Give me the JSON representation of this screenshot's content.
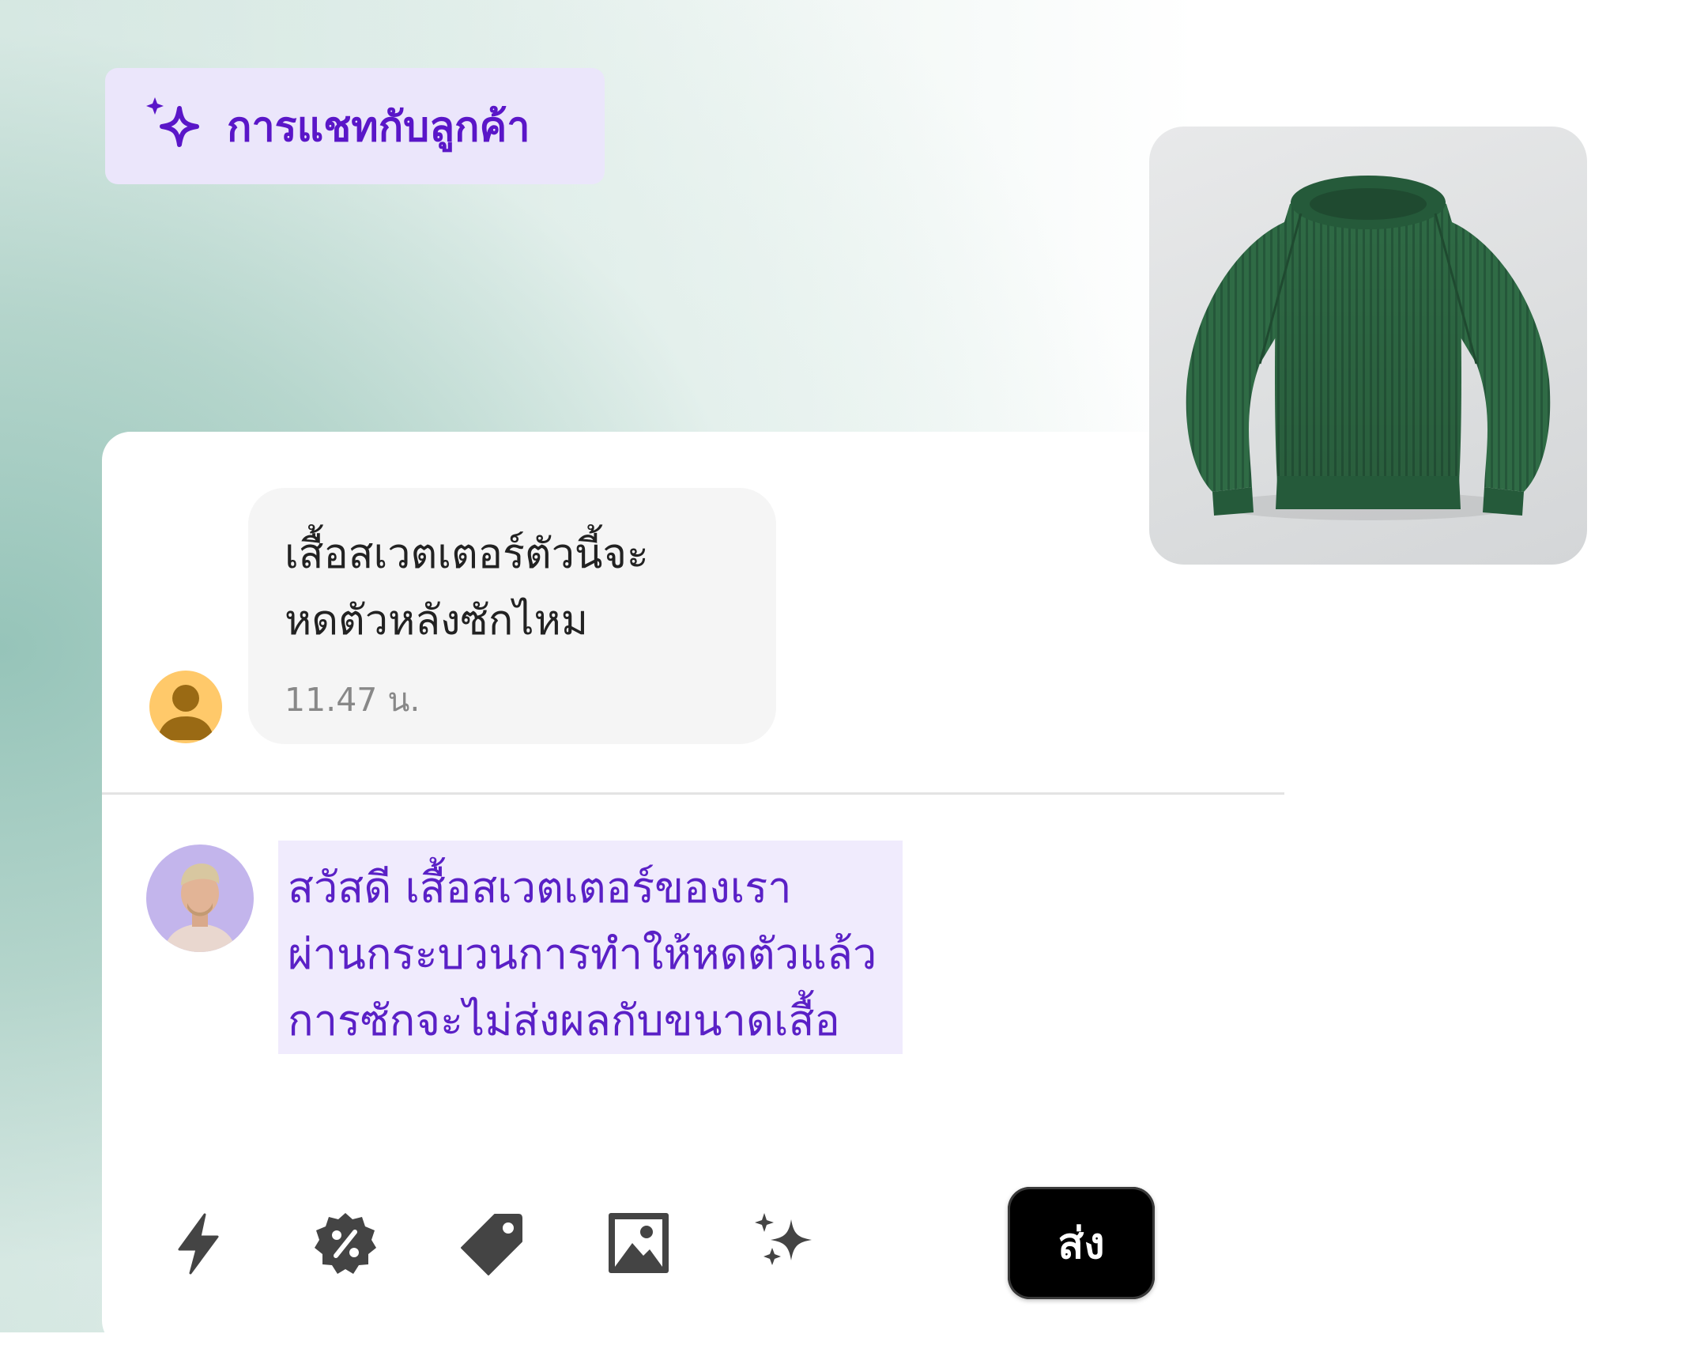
{
  "header": {
    "title": "การแชทกับลูกค้า",
    "icon": "sparkle-icon",
    "accent_color": "#5a16c8",
    "badge_color": "#ebe6fb"
  },
  "product": {
    "image_icon": "green-sweater-image"
  },
  "customer_message": {
    "lines": [
      "เสื้อสเวตเตอร์ตัวนี้จะ",
      "หดตัวหลังซักไหม"
    ],
    "time": "11.47 น.",
    "avatar_icon": "person-icon",
    "avatar_color": "#ffc96a"
  },
  "reply_draft": {
    "lines": [
      "สวัสดี เสื้อสเวตเตอร์ของเรา",
      "ผ่านกระบวนการทำให้หดตัวแล้ว",
      "การซักจะไม่ส่งผลกับขนาดเสื้อ"
    ],
    "text_color": "#5a20c6",
    "highlight_color": "#f0ebfd"
  },
  "toolbar": {
    "tools": [
      {
        "name": "lightning-icon"
      },
      {
        "name": "discount-icon"
      },
      {
        "name": "tag-icon"
      },
      {
        "name": "image-icon"
      },
      {
        "name": "sparkles-icon"
      }
    ],
    "send_label": "ส่ง"
  }
}
